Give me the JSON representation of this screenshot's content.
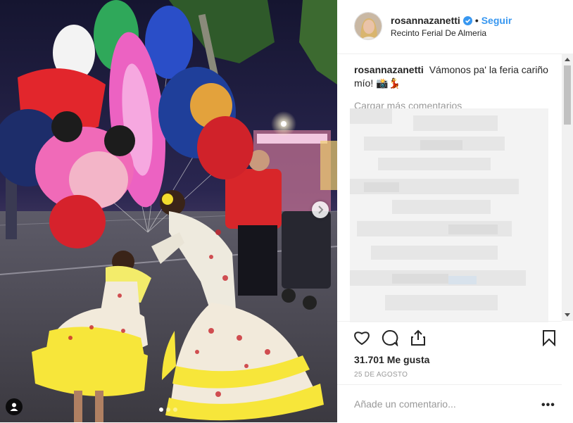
{
  "post": {
    "username": "rosannazanetti",
    "separator": "•",
    "follow_label": "Seguir",
    "location": "Recinto Ferial De Almeria",
    "caption_text": "Vámonos pa' la feria cariño mío! 📸💃",
    "load_more_label": "Cargar más comentarios",
    "likes_label": "31.701 Me gusta",
    "date_label": "25 DE AGOSTO",
    "comment_placeholder": "Añade un comentario...",
    "more_options": "•••"
  },
  "carousel": {
    "total_slides": 3,
    "active_slide": 1
  },
  "colors": {
    "follow_blue": "#3897f0",
    "verified_blue": "#3897f0",
    "text": "#262626",
    "muted": "#999999",
    "border": "#efefef"
  },
  "icons": {
    "verified": "verified-badge-icon",
    "heart": "heart-icon",
    "comment": "comment-icon",
    "share": "share-icon",
    "bookmark": "bookmark-icon",
    "next": "chevron-right-icon",
    "tag": "user-tag-icon"
  }
}
